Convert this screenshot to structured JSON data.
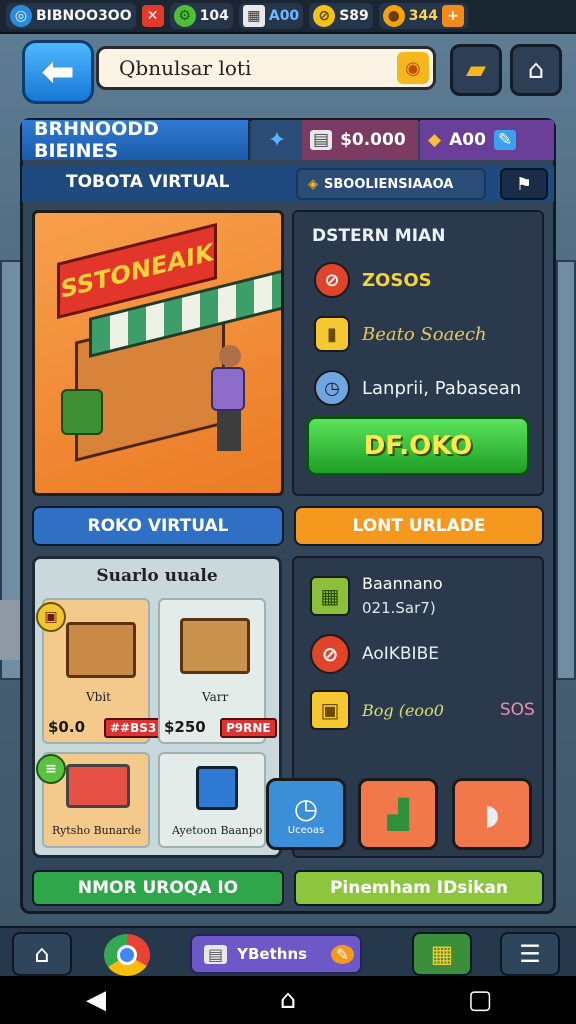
{
  "status_bar": {
    "account": "BIBNOO3OO",
    "gems": "104",
    "level": "A00",
    "coins": "S89",
    "gold": "344"
  },
  "header": {
    "search_text": "Qbnulsar loti"
  },
  "panel": {
    "title": "BRHNOODD BIEINES",
    "stat_money": "$0.000",
    "stat_level": "A00",
    "subtitle": "TOBOTA VIRTUAL",
    "chip_label": "SBOOLIENSIAAOA"
  },
  "scene": {
    "sign_text": "SSTONEAIK"
  },
  "info": {
    "title": "DSTERN MIAN",
    "row1": "ZOSOS",
    "row2": "Beato Soaech",
    "row3": "Lanprii, Pabasean",
    "buy_label": "DF.OKO"
  },
  "tabs": {
    "left": "ROKO VIRTUAL",
    "right": "LONT URLADE"
  },
  "items": {
    "title": "Suarlo uuale",
    "card1_label": "Vbit",
    "card1_price": "$0.0",
    "card1_tag": "##BS3",
    "card2_label": "Varr",
    "card2_price": "$250",
    "card2_tag": "P9RNE",
    "card3_label": "Rytsho Bunarde",
    "card4_label": "Ayetoon Baanpo"
  },
  "list": {
    "row1_title": "Baannano",
    "row1_sub": "021.Sar7)",
    "row2_title": "AoIKBIBE",
    "row3_title": "Bog (eoo0",
    "row3_value": "SOS",
    "action1_label": "Uceoas"
  },
  "bottom": {
    "left_btn": "NMOR UROQA IO",
    "right_btn": "Pinemham IDsikan",
    "center_label": "YBethns"
  }
}
